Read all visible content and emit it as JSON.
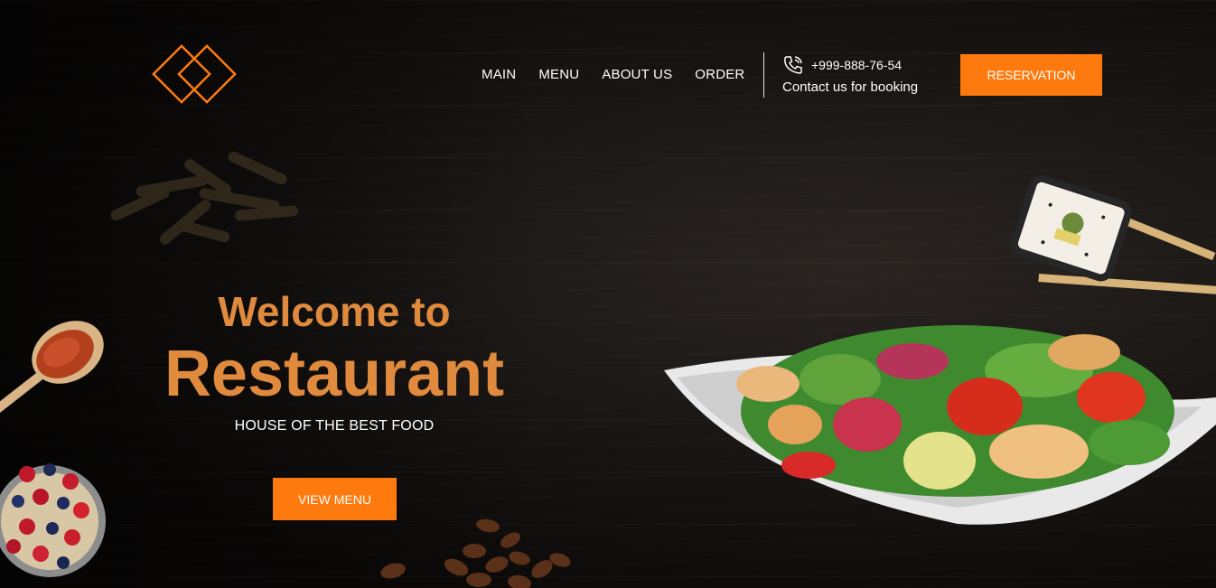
{
  "header": {
    "logo": "logo-icon",
    "nav": [
      {
        "label": "MAIN"
      },
      {
        "label": "MENU"
      },
      {
        "label": "ABOUT US"
      },
      {
        "label": "ORDER"
      }
    ],
    "contact": {
      "phone": "+999-888-76-54",
      "subtitle": "Contact us for booking",
      "icon": "phone-icon"
    },
    "reservation_label": "RESERVATION"
  },
  "hero": {
    "welcome": "Welcome to",
    "title": "Restaurant",
    "tagline": "HOUSE OF THE BEST FOOD",
    "cta_label": "VIEW MENU"
  },
  "colors": {
    "accent": "#ff7a0e",
    "title": "#e08a3e",
    "background": "#0d0b0a"
  }
}
